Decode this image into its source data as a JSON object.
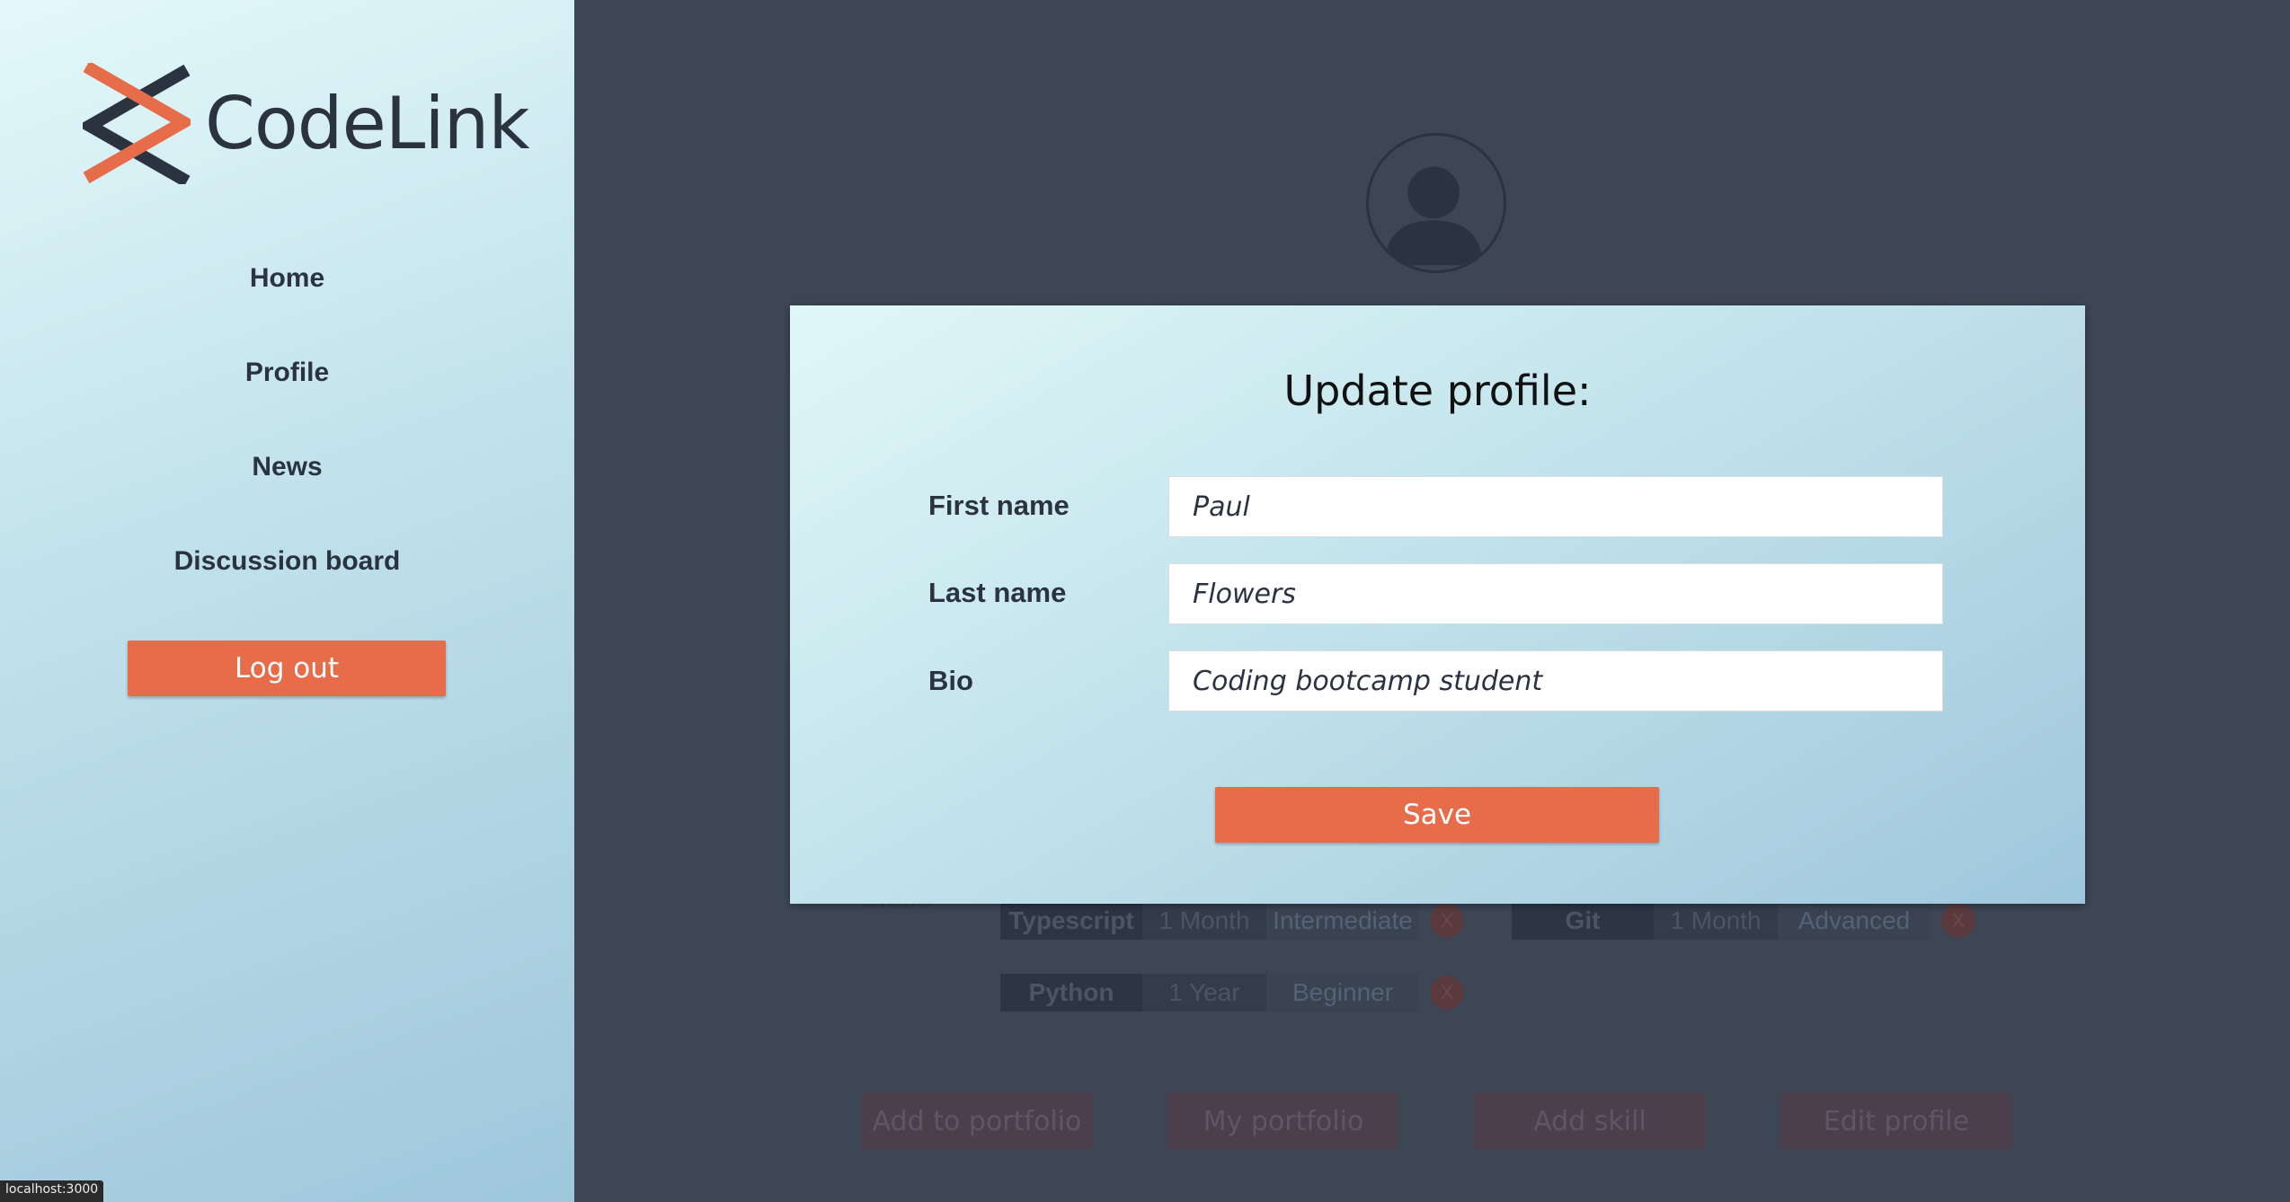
{
  "sidebar": {
    "logo_text": "CodeLink",
    "nav": [
      "Home",
      "Profile",
      "News",
      "Discussion board"
    ],
    "logout_label": "Log out"
  },
  "background_page": {
    "skills_label": "Skills",
    "skills": [
      {
        "name": "Typescript",
        "duration": "1 Month",
        "level": "Intermediate",
        "remove": "X"
      },
      {
        "name": "Git",
        "duration": "1 Month",
        "level": "Advanced",
        "remove": "X"
      },
      {
        "name": "Python",
        "duration": "1 Year",
        "level": "Beginner",
        "remove": "X"
      }
    ],
    "buttons": [
      "Add to portfolio",
      "My portfolio",
      "Add skill",
      "Edit profile"
    ]
  },
  "modal": {
    "title": "Update profile:",
    "fields": [
      {
        "label": "First name",
        "value": "Paul"
      },
      {
        "label": "Last name",
        "value": "Flowers"
      },
      {
        "label": "Bio",
        "value": "Coding bootcamp student"
      }
    ],
    "save_label": "Save"
  },
  "status_bar": {
    "text": "localhost:3000"
  },
  "colors": {
    "accent": "#e76c4a",
    "dark": "#2b3240",
    "overlay_bg": "#3d4655"
  }
}
